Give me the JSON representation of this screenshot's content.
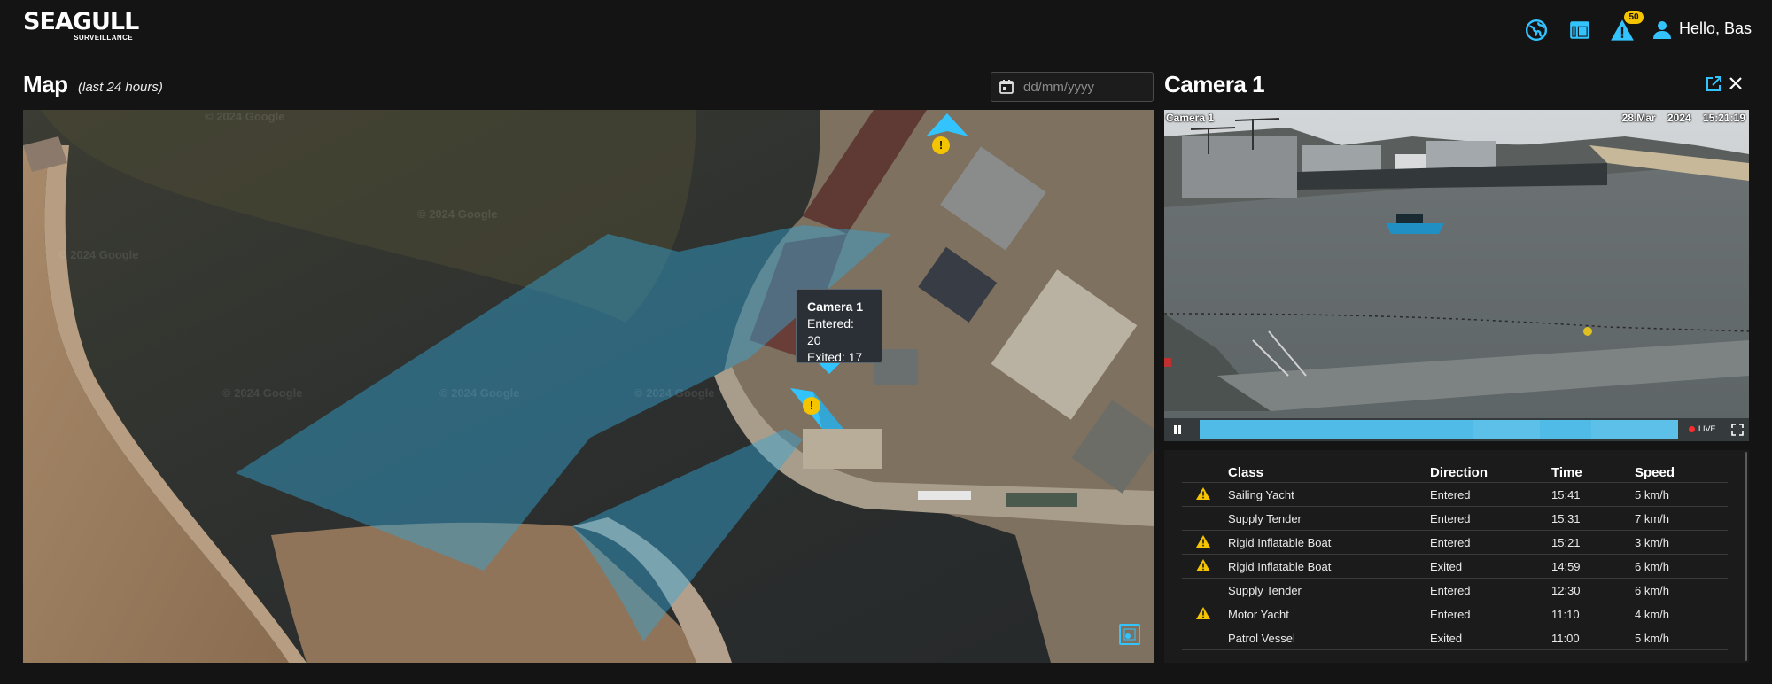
{
  "header": {
    "brand": "SEAGULL",
    "brand_sub": "SURVEILLANCE",
    "alert_count": "50",
    "greeting": "Hello, Bas",
    "icons": [
      "globe-icon",
      "table-layout-icon",
      "warning-icon",
      "user-icon"
    ]
  },
  "map": {
    "title": "Map",
    "subtitle": "(last 24 hours)",
    "date_placeholder": "dd/mm/yyyy",
    "watermark": "© 2024 Google",
    "tooltip": {
      "title": "Camera 1",
      "entered": "Entered: 20",
      "exited": "Exited: 17"
    }
  },
  "camera": {
    "title": "Camera 1",
    "overlay_label": "Camera 1",
    "overlay_timestamp": "28.Mar 2024 15:21:19",
    "live_label": "LIVE"
  },
  "detections": {
    "columns": [
      "Class",
      "Direction",
      "Time",
      "Speed"
    ],
    "rows": [
      {
        "warning": true,
        "class": "Sailing Yacht",
        "direction": "Entered",
        "time": "15:41",
        "speed": "5 km/h"
      },
      {
        "warning": false,
        "class": "Supply Tender",
        "direction": "Entered",
        "time": "15:31",
        "speed": "7 km/h"
      },
      {
        "warning": true,
        "class": "Rigid Inflatable Boat",
        "direction": "Entered",
        "time": "15:21",
        "speed": "3 km/h"
      },
      {
        "warning": true,
        "class": "Rigid Inflatable Boat",
        "direction": "Exited",
        "time": "14:59",
        "speed": "6 km/h"
      },
      {
        "warning": false,
        "class": "Supply Tender",
        "direction": "Entered",
        "time": "12:30",
        "speed": "6 km/h"
      },
      {
        "warning": true,
        "class": "Motor Yacht",
        "direction": "Entered",
        "time": "11:10",
        "speed": "4 km/h"
      },
      {
        "warning": false,
        "class": "Patrol Vessel",
        "direction": "Exited",
        "time": "11:00",
        "speed": "5 km/h"
      }
    ]
  },
  "colors": {
    "accent": "#33c3ff",
    "warning": "#f5c400",
    "background": "#141414",
    "live": "#ff2d2d"
  }
}
